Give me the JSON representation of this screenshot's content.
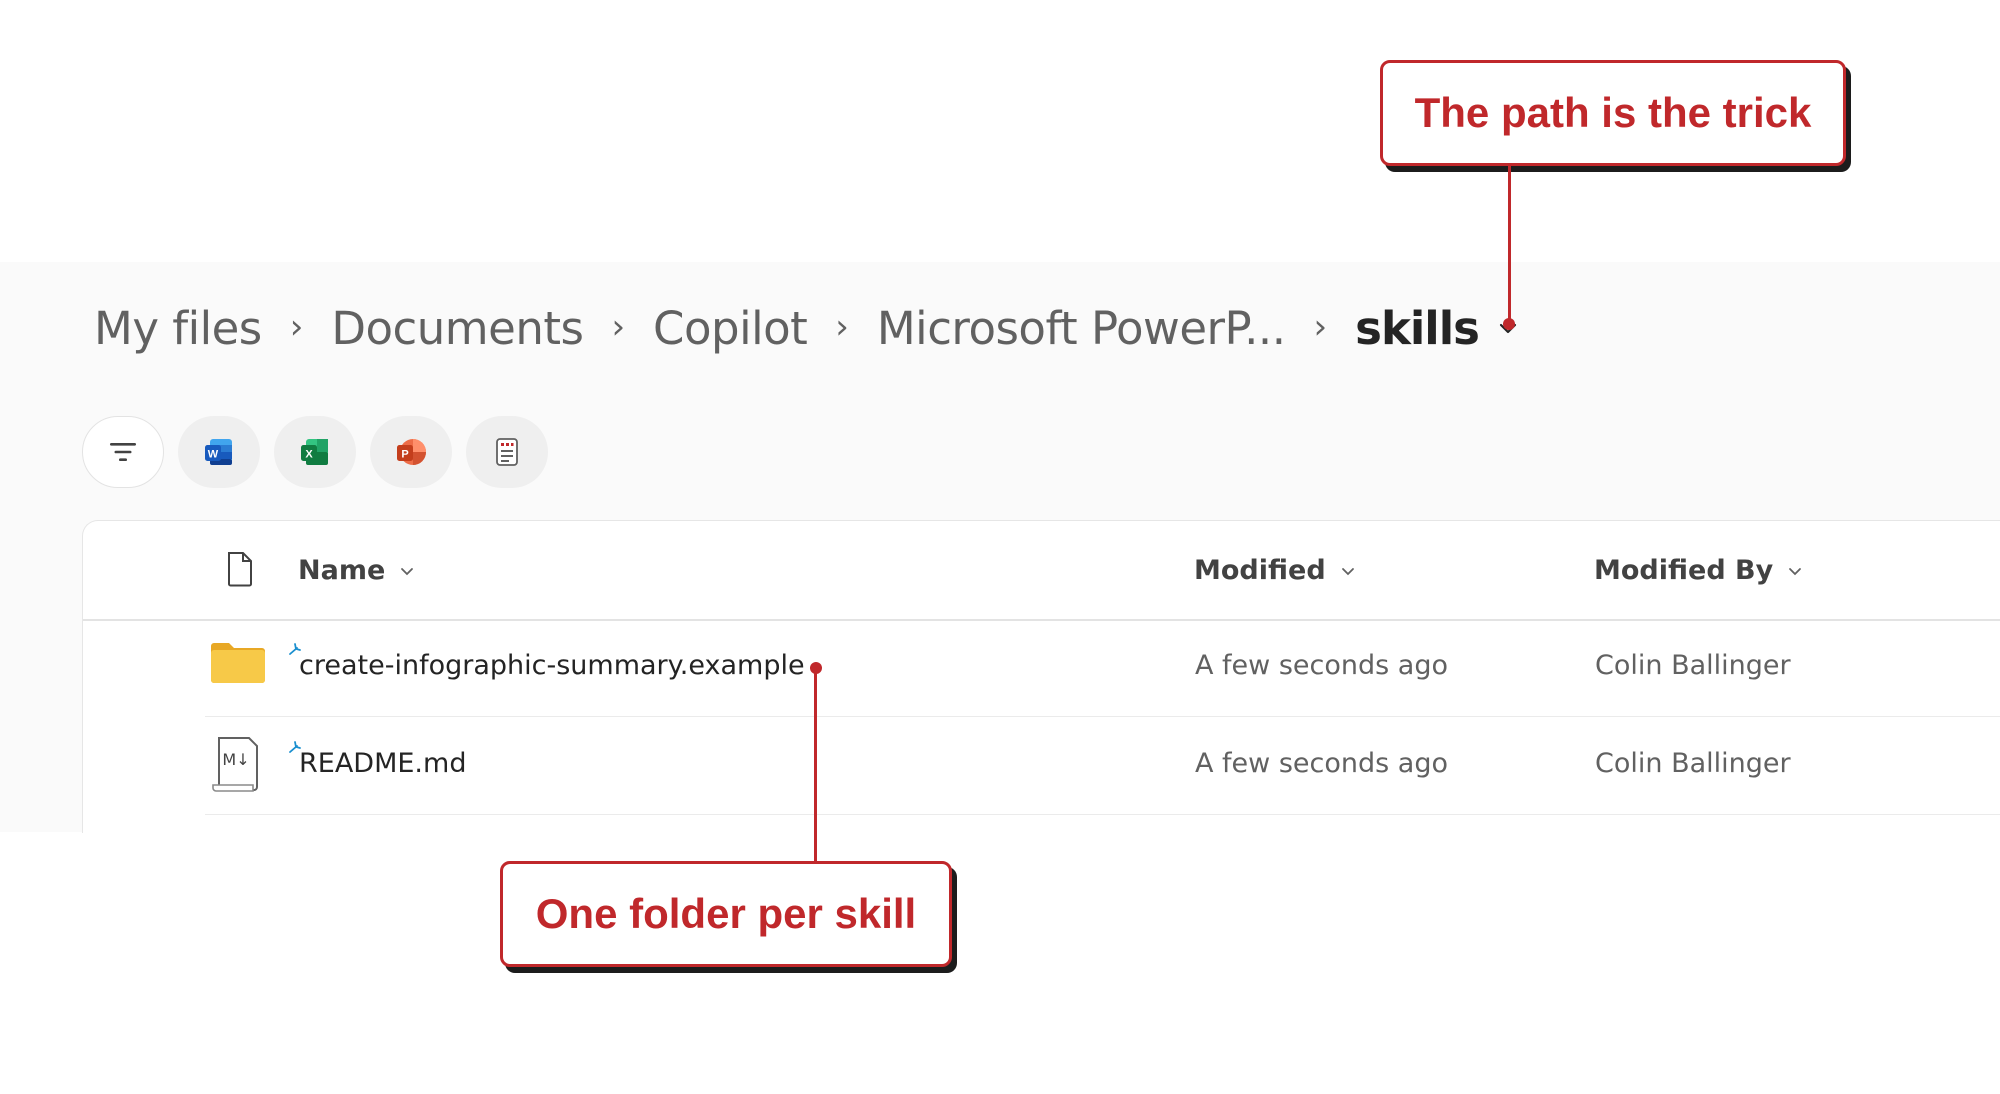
{
  "breadcrumb": {
    "items": [
      "My files",
      "Documents",
      "Copilot",
      "Microsoft PowerP..."
    ],
    "current": "skills",
    "separator": "›"
  },
  "filters": {
    "icons": [
      "filter-lines-icon",
      "word-icon",
      "excel-icon",
      "powerpoint-icon",
      "forms-icon"
    ]
  },
  "list": {
    "columns": {
      "name": "Name",
      "modified": "Modified",
      "modified_by": "Modified By"
    },
    "rows": [
      {
        "icon": "folder-icon",
        "name": "create-infographic-summary.example",
        "modified": "A few seconds ago",
        "modified_by": "Colin Ballinger"
      },
      {
        "icon": "markdown-file-icon",
        "name": "README.md",
        "modified": "A few seconds ago",
        "modified_by": "Colin Ballinger"
      }
    ]
  },
  "annotations": {
    "top": "The path is the trick",
    "bottom": "One folder per skill"
  },
  "colors": {
    "accent": "#c0282b",
    "folder": "#f7c948",
    "text_muted": "#616161"
  }
}
